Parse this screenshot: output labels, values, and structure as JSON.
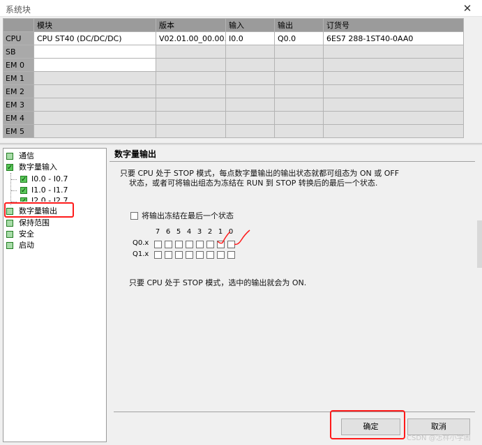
{
  "window": {
    "title": "系统块",
    "close_label": "✕"
  },
  "module_table": {
    "headers": [
      "模块",
      "版本",
      "输入",
      "输出",
      "订货号"
    ],
    "rows": [
      {
        "id": "CPU",
        "module": "CPU ST40 (DC/DC/DC)",
        "version": "V02.01.00_00.00...",
        "input": "I0.0",
        "output": "Q0.0",
        "order": "6ES7 288-1ST40-0AA0"
      },
      {
        "id": "SB",
        "module": "",
        "version": "",
        "input": "",
        "output": "",
        "order": ""
      },
      {
        "id": "EM 0",
        "module": "",
        "version": "",
        "input": "",
        "output": "",
        "order": ""
      },
      {
        "id": "EM 1",
        "module": "",
        "version": "",
        "input": "",
        "output": "",
        "order": ""
      },
      {
        "id": "EM 2",
        "module": "",
        "version": "",
        "input": "",
        "output": "",
        "order": ""
      },
      {
        "id": "EM 3",
        "module": "",
        "version": "",
        "input": "",
        "output": "",
        "order": ""
      },
      {
        "id": "EM 4",
        "module": "",
        "version": "",
        "input": "",
        "output": "",
        "order": ""
      },
      {
        "id": "EM 5",
        "module": "",
        "version": "",
        "input": "",
        "output": "",
        "order": ""
      }
    ]
  },
  "tree": {
    "items": [
      {
        "label": "通信",
        "checked": false
      },
      {
        "label": "数字量输入",
        "checked": true
      },
      {
        "label": "I0.0 - I0.7",
        "checked": true
      },
      {
        "label": "I1.0 - I1.7",
        "checked": true
      },
      {
        "label": "I2.0 - I2.7",
        "checked": true
      },
      {
        "label": "数字量输出",
        "checked": false
      },
      {
        "label": "保持范围",
        "checked": false
      },
      {
        "label": "安全",
        "checked": false
      },
      {
        "label": "启动",
        "checked": false
      }
    ]
  },
  "panel": {
    "heading": "数字量输出",
    "desc_line1": "只要 CPU 处于 STOP 模式，每点数字量输出的输出状态就都可组态为 ON 或 OFF",
    "desc_line2": "状态，或者可将输出组态为冻结在 RUN 到 STOP 转换后的最后一个状态.",
    "freeze_label": "将输出冻结在最后一个状态",
    "bit_labels": [
      "7",
      "6",
      "5",
      "4",
      "3",
      "2",
      "1",
      "0"
    ],
    "rows": [
      {
        "label": "Q0.x"
      },
      {
        "label": "Q1.x"
      }
    ],
    "footer_note": "只要 CPU 处于 STOP 模式，选中的输出就会为 ON."
  },
  "buttons": {
    "ok": "确定",
    "cancel": "取消"
  },
  "watermark": "CSDN @怎样小学困",
  "colors": {
    "highlight_red": "#ff1a1a",
    "check_green": "#5ac85a",
    "header_gray": "#9b9b9b"
  }
}
